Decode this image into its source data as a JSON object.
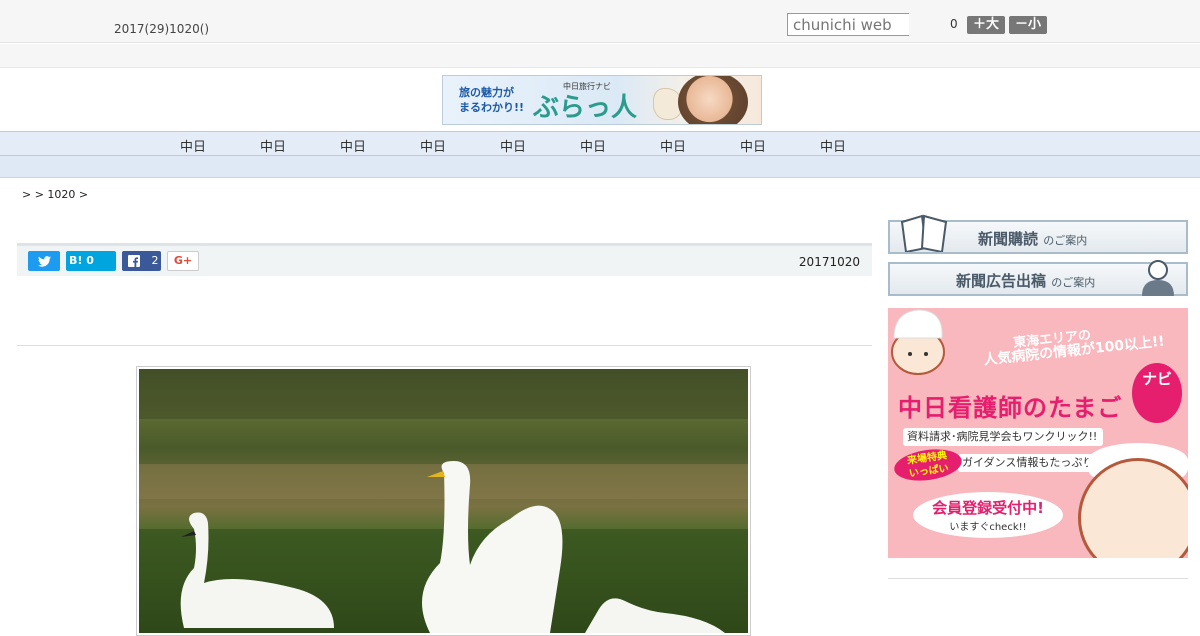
{
  "header": {
    "date": "2017(29)1020()",
    "search_placeholder": "chunichi web",
    "font_size_value": "0",
    "font_large_label": "＋大",
    "font_small_label": "－小"
  },
  "banner": {
    "tagline": "旅の魅力が\nまるわかり!!",
    "brand_small": "中日旅行ナビ",
    "brand_big": "ぶらっ人"
  },
  "nav": {
    "items": [
      "中日",
      "中日",
      "中日",
      "中日",
      "中日",
      "中日",
      "中日",
      "中日",
      "中日"
    ]
  },
  "breadcrumb": ">  > 1020 >",
  "share": {
    "hatena_label": "B! 0",
    "facebook_count": "2",
    "gplus_label": "G+",
    "article_date": "20171020"
  },
  "sidebar": {
    "subscribe_label": "新聞購読",
    "subscribe_suffix": "のご案内",
    "ad_label": "新聞広告出稿",
    "ad_suffix": "のご案内",
    "nurse_ad": {
      "line1": "東海エリアの",
      "line2": "人気病院の情報が100以上!!",
      "title": "中日看護師のたまご",
      "navi": "ナビ",
      "pill1": "資料請求･病院見学会もワンクリック!!",
      "pill2": "ガイダンス情報もたっぷり!!",
      "badge": "来場特典\nいっぱい",
      "bubble_main": "会員登録受付中!",
      "bubble_sub": "いますぐcheck!!"
    }
  }
}
